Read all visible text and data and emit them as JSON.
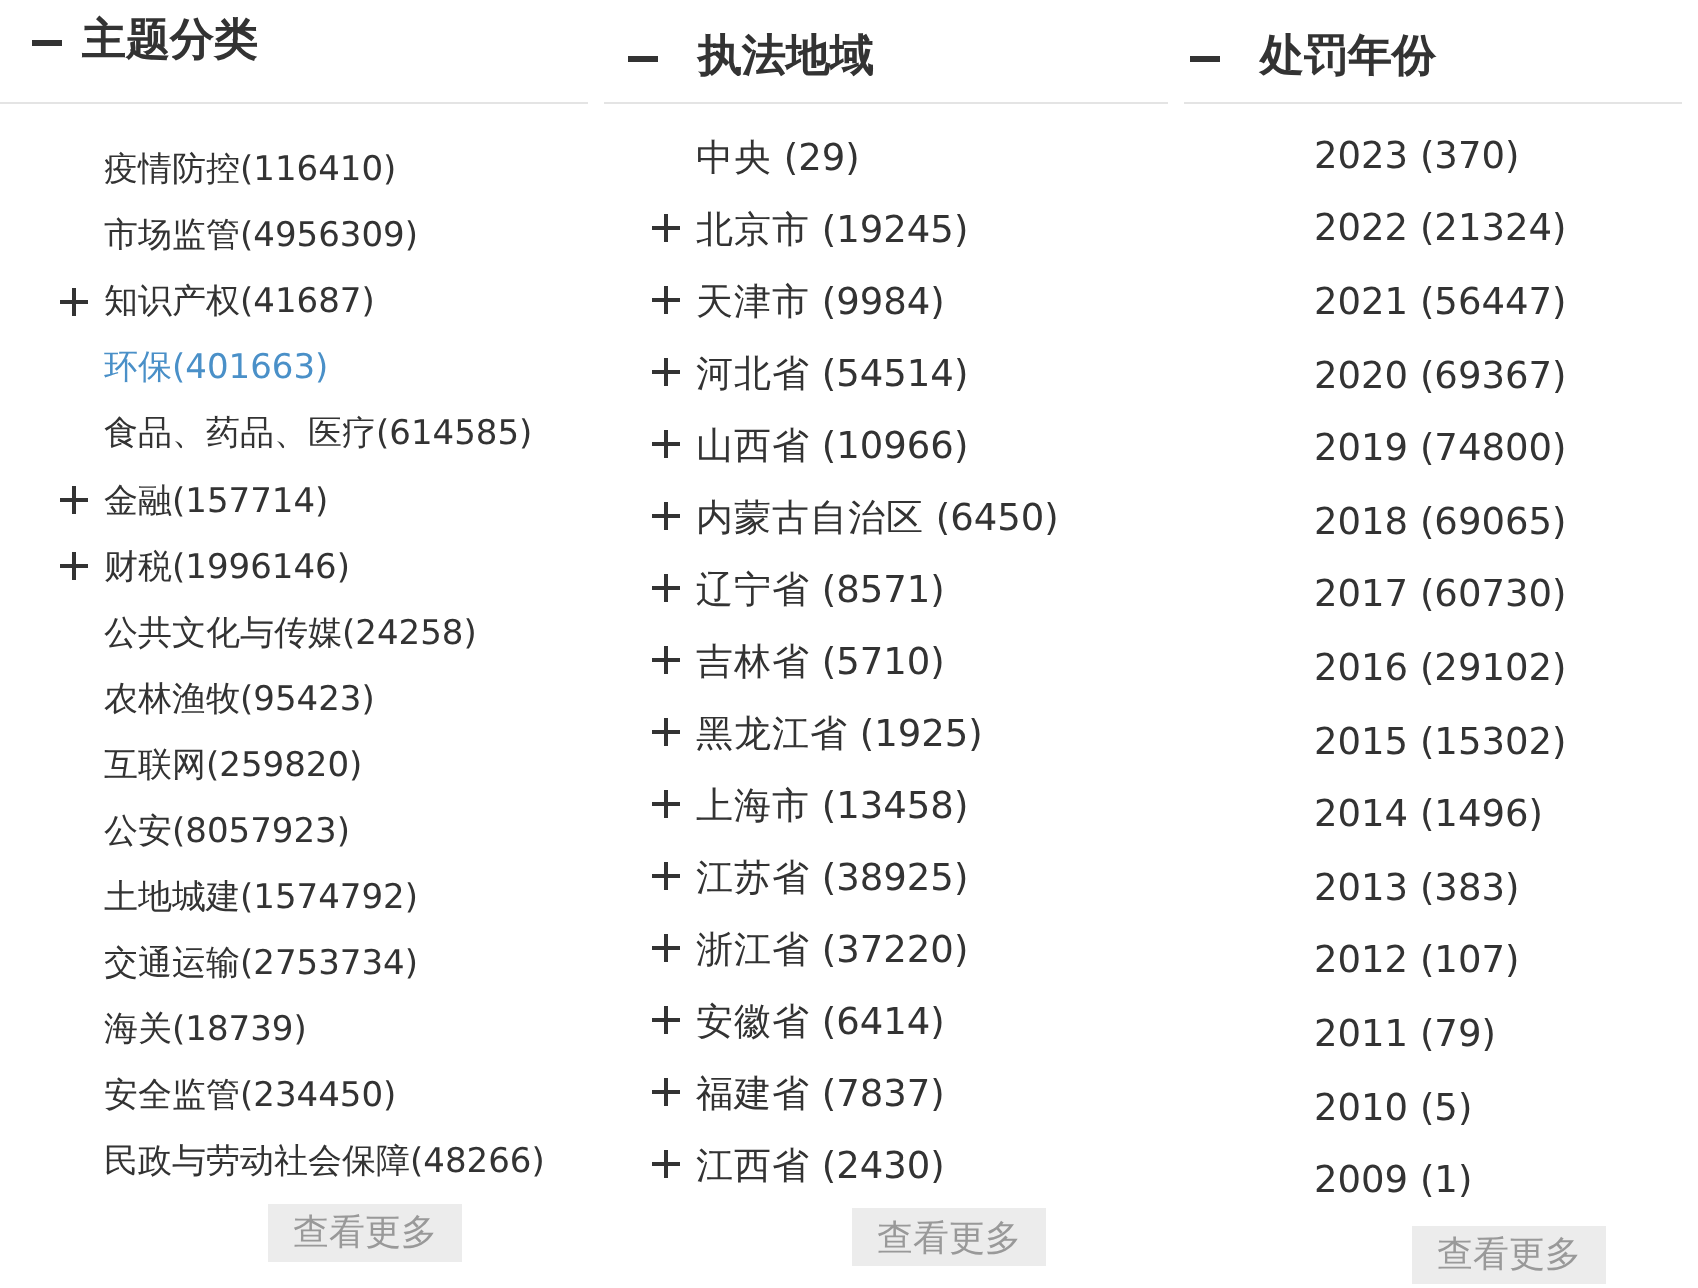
{
  "panels": [
    {
      "title": "主题分类",
      "expanded": true,
      "items": [
        {
          "label": "疫情防控(116410)",
          "expandable": false,
          "selected": false
        },
        {
          "label": "市场监管(4956309)",
          "expandable": false,
          "selected": false
        },
        {
          "label": "知识产权(41687)",
          "expandable": true,
          "selected": false
        },
        {
          "label": "环保(401663)",
          "expandable": false,
          "selected": true
        },
        {
          "label": "食品、药品、医疗(614585)",
          "expandable": false,
          "selected": false
        },
        {
          "label": "金融(157714)",
          "expandable": true,
          "selected": false
        },
        {
          "label": "财税(1996146)",
          "expandable": true,
          "selected": false
        },
        {
          "label": "公共文化与传媒(24258)",
          "expandable": false,
          "selected": false
        },
        {
          "label": "农林渔牧(95423)",
          "expandable": false,
          "selected": false
        },
        {
          "label": "互联网(259820)",
          "expandable": false,
          "selected": false
        },
        {
          "label": "公安(8057923)",
          "expandable": false,
          "selected": false
        },
        {
          "label": "土地城建(1574792)",
          "expandable": false,
          "selected": false
        },
        {
          "label": "交通运输(2753734)",
          "expandable": false,
          "selected": false
        },
        {
          "label": "海关(18739)",
          "expandable": false,
          "selected": false
        },
        {
          "label": "安全监管(234450)",
          "expandable": false,
          "selected": false
        },
        {
          "label": "民政与劳动社会保障(48266)",
          "expandable": false,
          "selected": false
        }
      ],
      "more_button": "查看更多"
    },
    {
      "title": "执法地域",
      "expanded": true,
      "items": [
        {
          "label": "中央 (29)",
          "expandable": false,
          "selected": false
        },
        {
          "label": "北京市 (19245)",
          "expandable": true,
          "selected": false
        },
        {
          "label": "天津市 (9984)",
          "expandable": true,
          "selected": false
        },
        {
          "label": "河北省 (54514)",
          "expandable": true,
          "selected": false
        },
        {
          "label": "山西省 (10966)",
          "expandable": true,
          "selected": false
        },
        {
          "label": "内蒙古自治区 (6450)",
          "expandable": true,
          "selected": false
        },
        {
          "label": "辽宁省 (8571)",
          "expandable": true,
          "selected": false
        },
        {
          "label": "吉林省 (5710)",
          "expandable": true,
          "selected": false
        },
        {
          "label": "黑龙江省 (1925)",
          "expandable": true,
          "selected": false
        },
        {
          "label": "上海市 (13458)",
          "expandable": true,
          "selected": false
        },
        {
          "label": "江苏省 (38925)",
          "expandable": true,
          "selected": false
        },
        {
          "label": "浙江省 (37220)",
          "expandable": true,
          "selected": false
        },
        {
          "label": "安徽省 (6414)",
          "expandable": true,
          "selected": false
        },
        {
          "label": "福建省 (7837)",
          "expandable": true,
          "selected": false
        },
        {
          "label": "江西省 (2430)",
          "expandable": true,
          "selected": false
        }
      ],
      "more_button": "查看更多"
    },
    {
      "title": "处罚年份",
      "expanded": true,
      "items": [
        {
          "label": "2023 (370)",
          "expandable": false,
          "selected": false
        },
        {
          "label": "2022 (21324)",
          "expandable": false,
          "selected": false
        },
        {
          "label": "2021 (56447)",
          "expandable": false,
          "selected": false
        },
        {
          "label": "2020 (69367)",
          "expandable": false,
          "selected": false
        },
        {
          "label": "2019 (74800)",
          "expandable": false,
          "selected": false
        },
        {
          "label": "2018 (69065)",
          "expandable": false,
          "selected": false
        },
        {
          "label": "2017 (60730)",
          "expandable": false,
          "selected": false
        },
        {
          "label": "2016 (29102)",
          "expandable": false,
          "selected": false
        },
        {
          "label": "2015 (15302)",
          "expandable": false,
          "selected": false
        },
        {
          "label": "2014 (1496)",
          "expandable": false,
          "selected": false
        },
        {
          "label": "2013 (383)",
          "expandable": false,
          "selected": false
        },
        {
          "label": "2012 (107)",
          "expandable": false,
          "selected": false
        },
        {
          "label": "2011 (79)",
          "expandable": false,
          "selected": false
        },
        {
          "label": "2010 (5)",
          "expandable": false,
          "selected": false
        },
        {
          "label": "2009 (1)",
          "expandable": false,
          "selected": false
        }
      ],
      "more_button": "查看更多"
    }
  ]
}
